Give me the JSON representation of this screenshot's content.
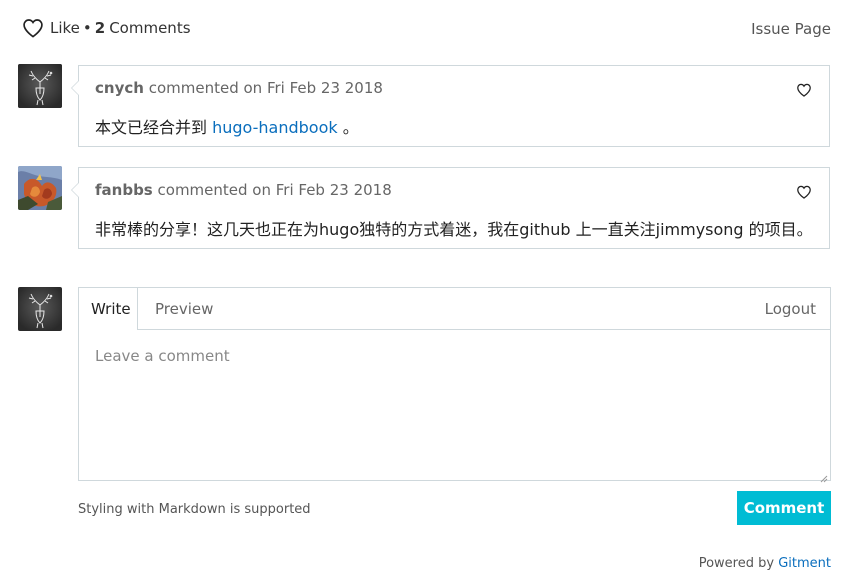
{
  "header": {
    "like_label": "Like",
    "dot": "•",
    "comment_count": "2",
    "comments_label": "Comments",
    "issue_page_label": "Issue Page"
  },
  "comments": [
    {
      "author": "cnych",
      "meta": "commented on Fri Feb 23 2018",
      "body_prefix": "本文已经合并到",
      "link_text": "hugo-handbook",
      "body_suffix": "。"
    },
    {
      "author": "fanbbs",
      "meta": "commented on Fri Feb 23 2018",
      "body": "非常棒的分享！这几天也正在为hugo独特的方式着迷，我在github 上一直关注jimmysong 的项目。"
    }
  ],
  "editor": {
    "tab_write": "Write",
    "tab_preview": "Preview",
    "logout_label": "Logout",
    "placeholder": "Leave a comment"
  },
  "footer": {
    "markdown_note": "Styling with Markdown is supported",
    "comment_button": "Comment",
    "powered_by": "Powered by",
    "gitment_link": "Gitment"
  },
  "icons": {
    "like": "heart-icon",
    "comment_like": "heart-icon",
    "resize": "resize-handle-icon"
  },
  "colors": {
    "accent": "#00bcd4",
    "link": "#0a6ebd",
    "border": "#cfd8dc"
  }
}
